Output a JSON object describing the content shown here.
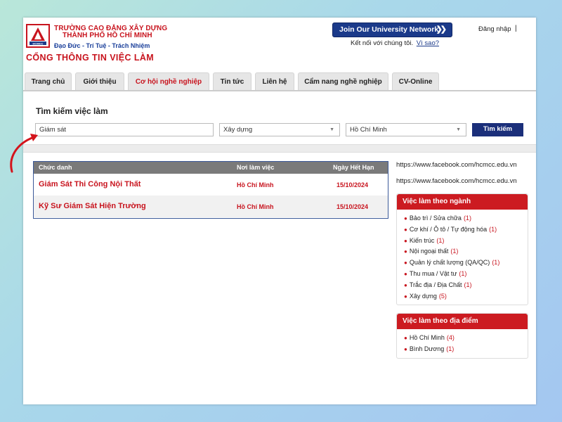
{
  "header": {
    "school_line1": "TRƯỜNG CAO ĐẲNG XÂY DỰNG",
    "school_line2": "THÀNH PHỐ HỒ CHÍ MINH",
    "logo_caption": "HCMCC",
    "motto": "Đạo Đức - Trí Tuệ -  Trách Nhiệm",
    "portal_title": "CỔNG THÔNG TIN VIỆC LÀM",
    "join_button": "Join Our University Network",
    "connect_text": "Kết nối với chúng tôi.",
    "connect_link": "Vì sao?",
    "login": "Đăng nhập",
    "login_separator": "|"
  },
  "nav": {
    "tabs": [
      {
        "label": "Trang chủ"
      },
      {
        "label": "Giới thiệu"
      },
      {
        "label": "Cơ hội nghề nghiệp"
      },
      {
        "label": "Tin tức"
      },
      {
        "label": "Liên hệ"
      },
      {
        "label": "Cẩm nang nghề nghiệp"
      },
      {
        "label": "CV-Online"
      }
    ],
    "active_index": 2
  },
  "search": {
    "title": "Tìm kiếm việc làm",
    "keyword_value": "Giám sát",
    "category_value": "Xây dựng",
    "location_value": "Hồ Chí Minh",
    "button": "Tìm kiếm"
  },
  "results": {
    "columns": [
      "Chức danh",
      "Nơi làm việc",
      "Ngày Hết Hạn"
    ],
    "rows": [
      {
        "title": "Giám Sát Thi Công Nội Thất",
        "location": "Hồ Chí Minh",
        "deadline": "15/10/2024"
      },
      {
        "title": "Kỹ Sư Giám Sát Hiện Trường",
        "location": "Hồ Chí Minh",
        "deadline": "15/10/2024"
      }
    ]
  },
  "sidebar": {
    "links": [
      "https://www.facebook.com/hcmcc.edu.vn",
      "https://www.facebook.com/hcmcc.edu.vn"
    ],
    "by_industry": {
      "title": "Việc làm theo ngành",
      "items": [
        {
          "label": "Bảo trì / Sửa chữa",
          "count": "(1)"
        },
        {
          "label": "Cơ khí / Ô tô / Tự động hóa",
          "count": "(1)"
        },
        {
          "label": "Kiến trúc",
          "count": "(1)"
        },
        {
          "label": "Nội ngoại thất",
          "count": "(1)"
        },
        {
          "label": "Quản lý chất lượng (QA/QC)",
          "count": "(1)"
        },
        {
          "label": "Thu mua / Vật tư",
          "count": "(1)"
        },
        {
          "label": "Trắc địa / Địa Chất",
          "count": "(1)"
        },
        {
          "label": "Xây dựng",
          "count": "(5)"
        }
      ]
    },
    "by_location": {
      "title": "Việc làm theo địa điểm",
      "items": [
        {
          "label": "Hồ Chí Minh",
          "count": "(4)"
        },
        {
          "label": "Bình Dương",
          "count": "(1)"
        }
      ]
    }
  },
  "colors": {
    "brand_red": "#c8141e",
    "brand_blue": "#1b3a8a",
    "table_header": "#7a7a7a"
  }
}
